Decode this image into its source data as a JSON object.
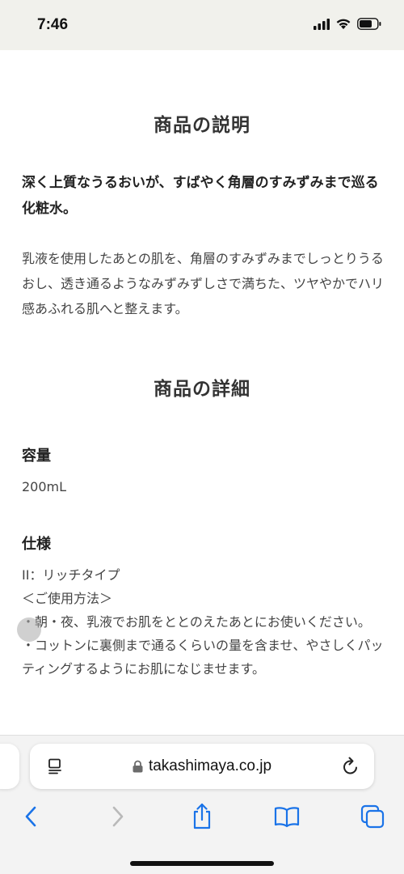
{
  "status_bar": {
    "time": "7:46"
  },
  "description": {
    "heading": "商品の説明",
    "lead": "深く上質なうるおいが、すばやく角層のすみずみまで巡る化粧水。",
    "body": "乳液を使用したあとの肌を、角層のすみずみまでしっとりうるおし、透き通るようなみずみずしさで満ちた、ツヤやかでハリ感あふれる肌へと整えます。"
  },
  "details": {
    "heading": "商品の詳細",
    "capacity_label": "容量",
    "capacity_value": "200mL",
    "spec_label": "仕様",
    "spec_lines": [
      "II：リッチタイプ",
      "＜ご使用方法＞",
      "・朝・夜、乳液でお肌をととのえたあとにお使いください。",
      "・コットンに裏側まで通るくらいの量を含ませ、やさしくパッティングするようにお肌になじませます。"
    ]
  },
  "browser": {
    "url": "takashimaya.co.jp",
    "icons": {
      "reader": "reader-icon",
      "lock": "lock-icon",
      "reload": "reload-icon",
      "back": "chevron-left-icon",
      "forward": "chevron-right-icon",
      "share": "share-icon",
      "bookmarks": "book-icon",
      "tabs": "tabs-icon"
    },
    "accent_color": "#1a73e8"
  }
}
